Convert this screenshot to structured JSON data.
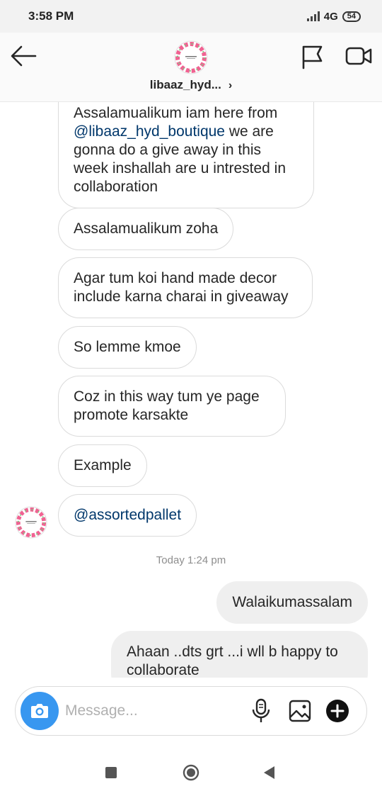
{
  "status_bar": {
    "time": "3:58 PM",
    "network": "4G",
    "battery": "54"
  },
  "header": {
    "username": "libaaz_hyd...",
    "chevron": "›",
    "avatar_text": "LIBAAZ HYD BOUTIQUE",
    "icons": [
      "arrow-left-icon",
      "flag-icon",
      "video-camera-icon"
    ]
  },
  "chat": {
    "received": [
      {
        "text_before": "Assalamualikum iam here from ",
        "mention": "@libaaz_hyd_boutique",
        "text_after": " we are gonna do a give away in this week inshallah are u intrested in collaboration"
      },
      {
        "text": "Assalamualikum zoha"
      },
      {
        "text": "Agar tum koi hand made decor include karna charai in giveaway"
      },
      {
        "text": "So lemme kmoe"
      },
      {
        "text": "Coz in this way tum ye page promote karsakte"
      },
      {
        "text": "Example"
      },
      {
        "mention": "@assortedpallet"
      }
    ],
    "timestamp": "Today 1:24 pm",
    "sent": [
      {
        "text": "Walaikumassalam"
      },
      {
        "text": "Ahaan ..dts grt ...i wll b happy to collaborate"
      }
    ]
  },
  "composer": {
    "placeholder": "Message...",
    "icons": [
      "camera-icon",
      "microphone-icon",
      "image-icon",
      "plus-circle-icon"
    ]
  },
  "colors": {
    "accent_blue": "#3897f0",
    "mention_blue": "#00376b",
    "bubble_border": "#dbdbdb",
    "sent_bubble": "#efefef",
    "timestamp_gray": "#8e8e8e"
  }
}
